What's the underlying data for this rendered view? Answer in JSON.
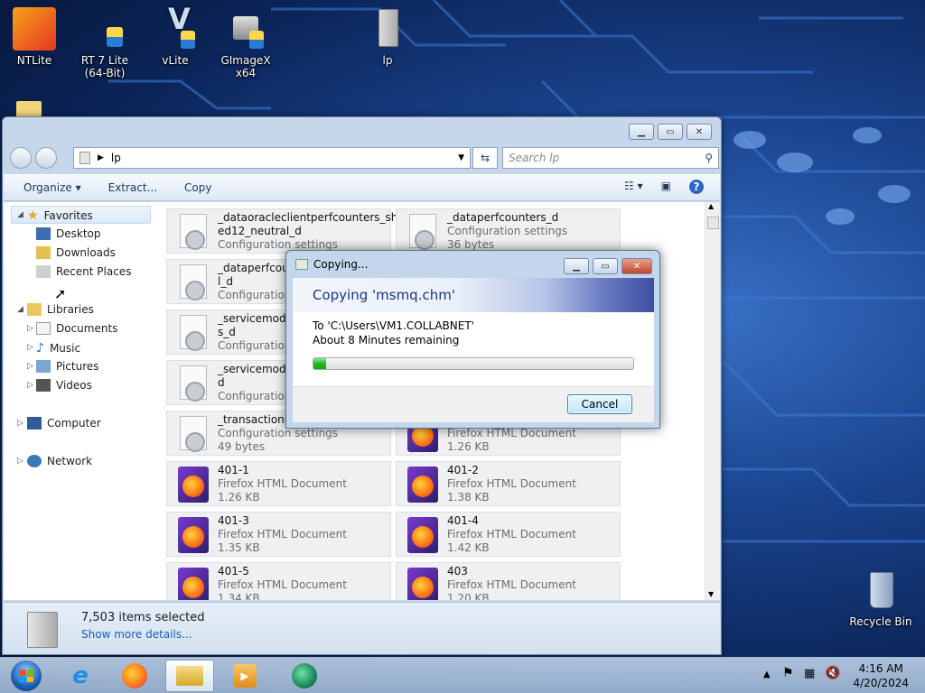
{
  "desktop": {
    "icons": [
      {
        "label": "NTLite"
      },
      {
        "label": "RT 7 Lite"
      },
      {
        "label": "(64-Bit)"
      },
      {
        "label": "vLite"
      },
      {
        "label": "GImageX x64"
      },
      {
        "label": "lp"
      },
      {
        "label": "Recycle Bin"
      }
    ]
  },
  "explorer": {
    "address": "lp",
    "search_placeholder": "Search lp",
    "toolbar": {
      "organize": "Organize",
      "extract": "Extract...",
      "copy": "Copy"
    },
    "nav": {
      "favorites": "Favorites",
      "desktop": "Desktop",
      "downloads": "Downloads",
      "recent": "Recent Places",
      "libraries": "Libraries",
      "documents": "Documents",
      "music": "Music",
      "pictures": "Pictures",
      "videos": "Videos",
      "computer": "Computer",
      "network": "Network"
    },
    "files": [
      {
        "name": "_dataoracleclientperfcounters_shar",
        "name2": "ed12_neutral_d",
        "type": "Configuration settings",
        "size": ""
      },
      {
        "name": "_dataperfcounters_d",
        "name2": "",
        "type": "Configuration settings",
        "size": "36 bytes"
      },
      {
        "name": "_dataperfcount",
        "name2": "l_d",
        "type": "Configuration",
        "size": ""
      },
      {
        "name": "",
        "name2": "",
        "type": "",
        "size": ""
      },
      {
        "name": "_servicemodel",
        "name2": "s_d",
        "type": "Configuration",
        "size": ""
      },
      {
        "name": "",
        "name2": "",
        "type": "",
        "size": ""
      },
      {
        "name": "_servicemodels",
        "name2": "d",
        "type": "Configuration",
        "size": ""
      },
      {
        "name": "",
        "name2": "",
        "type": "",
        "size": ""
      },
      {
        "name": "_transactionbri",
        "name2": "",
        "type": "Configuration settings",
        "size": "49 bytes"
      },
      {
        "name": "",
        "name2": "",
        "type": "Firefox HTML Document",
        "size": "1.26 KB"
      },
      {
        "name": "401-1",
        "name2": "",
        "type": "Firefox HTML Document",
        "size": "1.26 KB"
      },
      {
        "name": "401-2",
        "name2": "",
        "type": "Firefox HTML Document",
        "size": "1.38 KB"
      },
      {
        "name": "401-3",
        "name2": "",
        "type": "Firefox HTML Document",
        "size": "1.35 KB"
      },
      {
        "name": "401-4",
        "name2": "",
        "type": "Firefox HTML Document",
        "size": "1.42 KB"
      },
      {
        "name": "401-5",
        "name2": "",
        "type": "Firefox HTML Document",
        "size": "1.34 KB"
      },
      {
        "name": "403",
        "name2": "",
        "type": "Firefox HTML Document",
        "size": "1.20 KB"
      }
    ],
    "details": {
      "selected": "7,503 items selected",
      "more": "Show more details..."
    }
  },
  "copy_dialog": {
    "title": "Copying...",
    "heading": "Copying 'msmq.chm'",
    "to": "To 'C:\\Users\\VM1.COLLABNET'",
    "remaining": "About 8 Minutes remaining",
    "progress": 0.04,
    "cancel": "Cancel"
  },
  "taskbar": {
    "time": "4:16 AM",
    "date": "4/20/2024"
  },
  "colors": {
    "accent": "#1e3287",
    "progress": "#22b722"
  }
}
